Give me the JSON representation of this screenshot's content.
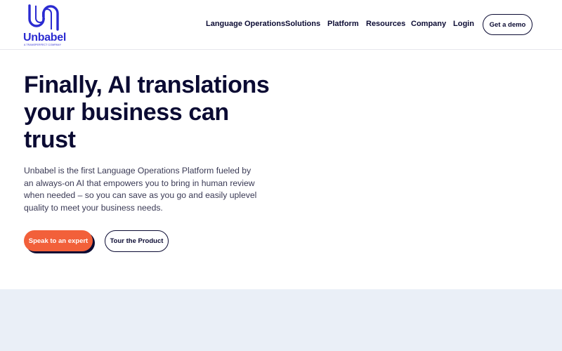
{
  "brand": {
    "name": "Unbabel",
    "tagline": "A TRANSPERFECT COMPANY",
    "color": "#2b2bd1"
  },
  "nav": {
    "items": [
      {
        "label": "Language Operations"
      },
      {
        "label": "Solutions"
      },
      {
        "label": "Platform"
      },
      {
        "label": "Resources"
      },
      {
        "label": "Company"
      },
      {
        "label": "Login"
      }
    ],
    "demo_label": "Get a demo"
  },
  "hero": {
    "title": "Finally, AI translations your business can trust",
    "description": "Unbabel is the first Language Operations Platform fueled by an always-on AI that empowers you to bring in human review when needed – so you can save as you go and easily uplevel quality to meet your business needs.",
    "primary_cta": "Speak to an expert",
    "secondary_cta": "Tour the Product"
  },
  "colors": {
    "primary_text": "#0b0b33",
    "accent_orange": "#f2603a",
    "band_background": "#eaeff7"
  }
}
